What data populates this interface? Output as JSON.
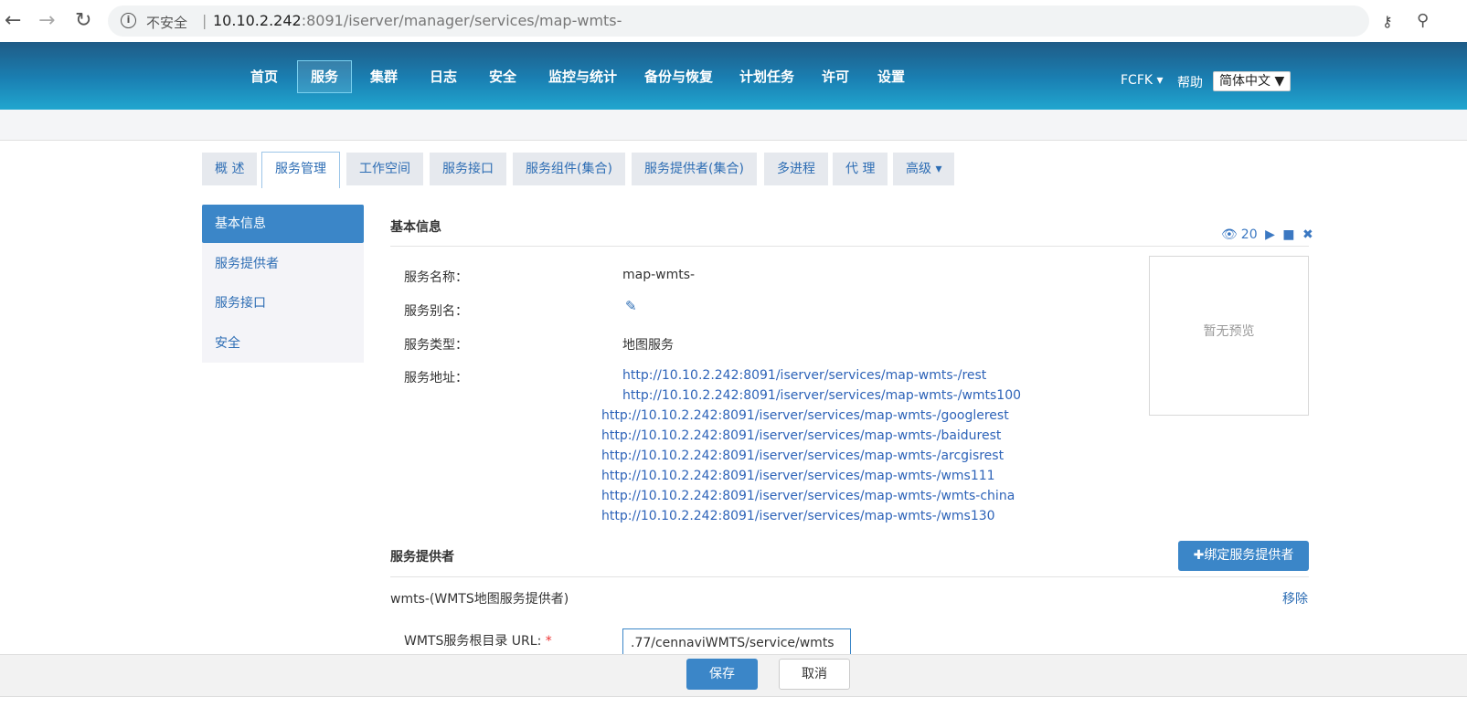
{
  "browser": {
    "security_label": "不安全",
    "separator": "|",
    "url_host": "10.10.2.242",
    "url_rest": ":8091/iserver/manager/services/map-wmts-"
  },
  "header": {
    "menu": [
      "首页",
      "服务",
      "集群",
      "日志",
      "安全",
      "监控与统计",
      "备份与恢复",
      "计划任务",
      "许可",
      "设置"
    ],
    "active_menu": "服务",
    "user": "FCFK",
    "user_caret": "▾",
    "help": "帮助",
    "language": "简体中文",
    "language_caret": "▼"
  },
  "subtabs": [
    "概 述",
    "服务管理",
    "工作空间",
    "服务接口",
    "服务组件(集合)",
    "服务提供者(集合)",
    "多进程",
    "代 理",
    "高级"
  ],
  "subtab_caret": "▾",
  "sidenav": [
    "基本信息",
    "服务提供者",
    "服务接口",
    "安全"
  ],
  "basic_info": {
    "title": "基本信息",
    "view_count": "20",
    "rows": [
      {
        "label": "服务名称：",
        "value": "map-wmts-"
      },
      {
        "label": "服务别名：",
        "value": ""
      },
      {
        "label": "服务类型：",
        "value": "地图服务"
      },
      {
        "label": "服务地址：",
        "value": ""
      }
    ],
    "links": [
      "http://10.10.2.242:8091/iserver/services/map-wmts-/rest",
      "http://10.10.2.242:8091/iserver/services/map-wmts-/wmts100",
      "http://10.10.2.242:8091/iserver/services/map-wmts-/googlerest",
      "http://10.10.2.242:8091/iserver/services/map-wmts-/baidurest",
      "http://10.10.2.242:8091/iserver/services/map-wmts-/arcgisrest",
      "http://10.10.2.242:8091/iserver/services/map-wmts-/wms111",
      "http://10.10.2.242:8091/iserver/services/map-wmts-/wmts-china",
      "http://10.10.2.242:8091/iserver/services/map-wmts-/wms130"
    ],
    "preview_text": "暂无预览"
  },
  "provider_section": {
    "title": "服务提供者",
    "bind_button": "✚绑定服务提供者",
    "provider_name": "wmts-(WMTS地图服务提供者)",
    "remove": "移除",
    "wmts_label": "WMTS服务根目录 URL:",
    "required_mark": "*",
    "wmts_value": ".77/cennaviWMTS/service/wmts"
  },
  "footer": {
    "save": "保存",
    "cancel": "取消"
  }
}
